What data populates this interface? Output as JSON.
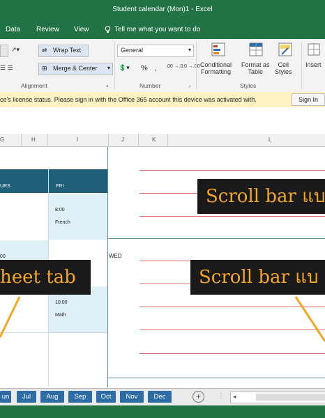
{
  "window": {
    "title": "Student calendar (Mon)1  -  Excel"
  },
  "ribbon_tabs": [
    "Data",
    "Review",
    "View"
  ],
  "tell_me": {
    "icon": "lightbulb-icon",
    "text": "Tell me what you want to do"
  },
  "alignment": {
    "wrap_text": "Wrap Text",
    "merge_center": "Merge & Center",
    "group_label": "Alignment"
  },
  "number": {
    "format_value": "General",
    "percent": "%",
    "comma": ",",
    "inc_decimal": ".00 →.0",
    "dec_decimal": ".0 →.00",
    "group_label": "Number"
  },
  "styles": {
    "conditional": [
      "Conditional",
      "Formatting"
    ],
    "format_table": [
      "Format as",
      "Table"
    ],
    "cell_styles": [
      "Cell",
      "Styles"
    ],
    "group_label": "Styles"
  },
  "cells_group": {
    "insert": "Insert"
  },
  "notice": {
    "text": "ce's license status. Please sign in with the Office 365 account this device was activated with.",
    "sign_in": "Sign In"
  },
  "columns": [
    "G",
    "H",
    "I",
    "J",
    "K",
    "L"
  ],
  "schedule": {
    "header_left": "URS",
    "header_right": "FRI",
    "time1": "8:00",
    "subject1": "French",
    "time_partial": "00",
    "time2": "10:00",
    "subject2": "Math",
    "wed": "WED"
  },
  "callouts": {
    "scroll1": "Scroll bar แบ",
    "sheet": "heet tab",
    "scroll2": "Scroll bar แบ"
  },
  "sheet_tabs": [
    "un",
    "Jul",
    "Aug",
    "Sep",
    "Oct",
    "Nov",
    "Dec"
  ],
  "colors": {
    "excel_green": "#217346",
    "tab_blue": "#2e6da4",
    "callout_bg": "#1a1a1a",
    "callout_text": "#f5a623",
    "schedule_header": "#1f5f7a",
    "cell_light": "#dff1f7"
  }
}
